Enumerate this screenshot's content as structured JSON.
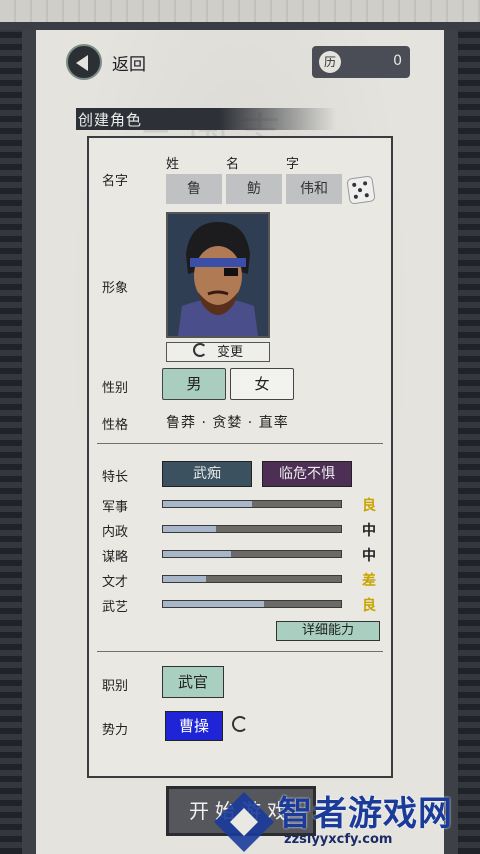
{
  "header": {
    "back_label": "返回",
    "coin_icon": "历",
    "coin_value": "0",
    "section_title": "创建角色"
  },
  "name": {
    "label": "名字",
    "heads": [
      "姓",
      "名",
      "字"
    ],
    "surname": "鲁",
    "given": "鲂",
    "courtesy": "伟和",
    "dice_icon": "dice-icon"
  },
  "appearance": {
    "label": "形象",
    "change_label": "变更"
  },
  "gender": {
    "label": "性别",
    "male": "男",
    "female": "女",
    "selected": "男"
  },
  "personality": {
    "label": "性格",
    "traits": "鲁莽 · 贪婪 · 直率"
  },
  "specialty": {
    "label": "特长",
    "items": [
      "武痴",
      "临危不惧"
    ]
  },
  "stats": [
    {
      "name": "军事",
      "value": 0.5,
      "grade": "良",
      "grade_color": "#c9a400"
    },
    {
      "name": "内政",
      "value": 0.3,
      "grade": "中",
      "grade_color": "#222222"
    },
    {
      "name": "谋略",
      "value": 0.38,
      "grade": "中",
      "grade_color": "#222222"
    },
    {
      "name": "文才",
      "value": 0.24,
      "grade": "差",
      "grade_color": "#c9a400"
    },
    {
      "name": "武艺",
      "value": 0.57,
      "grade": "良",
      "grade_color": "#c9a400"
    }
  ],
  "detail_label": "详细能力",
  "role": {
    "label": "职别",
    "value": "武官"
  },
  "faction": {
    "label": "势力",
    "value": "曹操",
    "color": "#1f24d6"
  },
  "start_label": "开始游戏",
  "watermark": {
    "name": "智者游戏网",
    "url": "zzslyyxcfy.com"
  }
}
